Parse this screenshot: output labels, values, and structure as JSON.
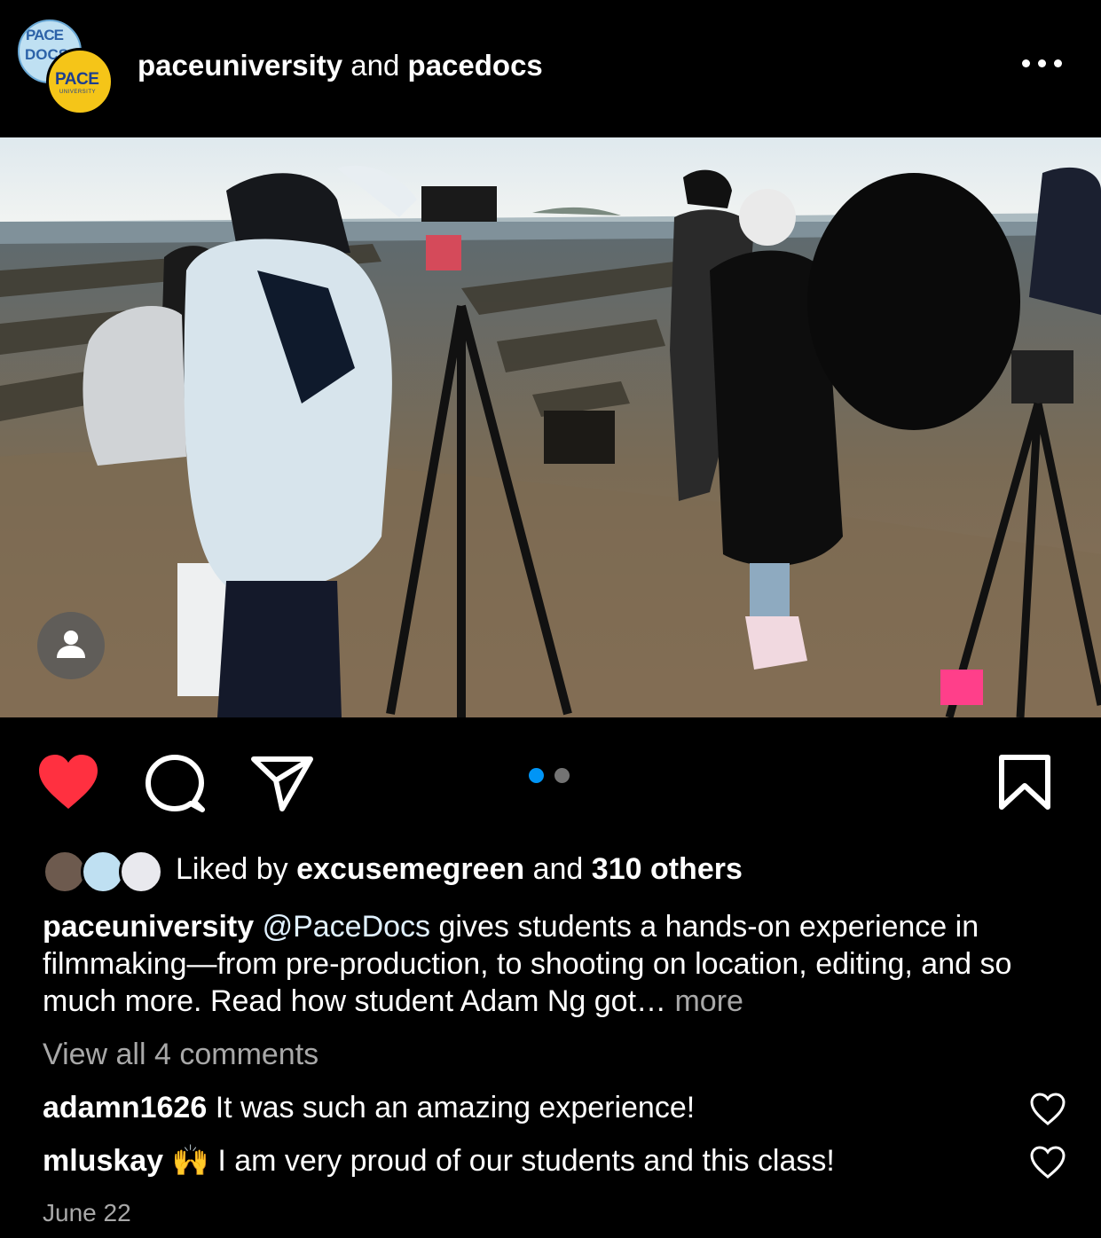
{
  "post": {
    "author_primary": "paceuniversity",
    "author_joiner": "and",
    "author_secondary": "pacedocs",
    "avatar_docs_text_1": "PACE",
    "avatar_docs_text_2": "DOCS",
    "avatar_pace_text": "PACE",
    "avatar_pace_subtext": "UNIVERSITY",
    "more_options_icon": "more-horizontal-icon"
  },
  "media": {
    "description_icon": "user-tag-icon",
    "carousel": {
      "count": 2,
      "active_index": 0
    }
  },
  "actions": {
    "like_icon": "heart-filled-icon",
    "comment_icon": "comment-icon",
    "share_icon": "send-icon",
    "save_icon": "bookmark-icon",
    "liked": true
  },
  "likes": {
    "prefix": "Liked by",
    "user": "excusemegreen",
    "joiner": "and",
    "others": "310 others"
  },
  "caption": {
    "username": "paceuniversity",
    "mention": "@PaceDocs",
    "text": "gives students a hands-on experience in filmmaking—from pre-production, to shooting on location, editing, and so much more. Read how student Adam Ng got…",
    "more_label": "more"
  },
  "comments": {
    "view_all": "View all 4 comments",
    "items": [
      {
        "username": "adamn1626",
        "text": "It was such an amazing experience!"
      },
      {
        "username": "mluskay",
        "emoji": "🙌",
        "text": "I am very proud of our students and this class!"
      }
    ]
  },
  "date": "June 22",
  "colors": {
    "background": "#000000",
    "like_red": "#ff3040",
    "carousel_active": "#0095f6",
    "carousel_inactive": "#737373",
    "secondary_text": "#a8a8a8"
  }
}
